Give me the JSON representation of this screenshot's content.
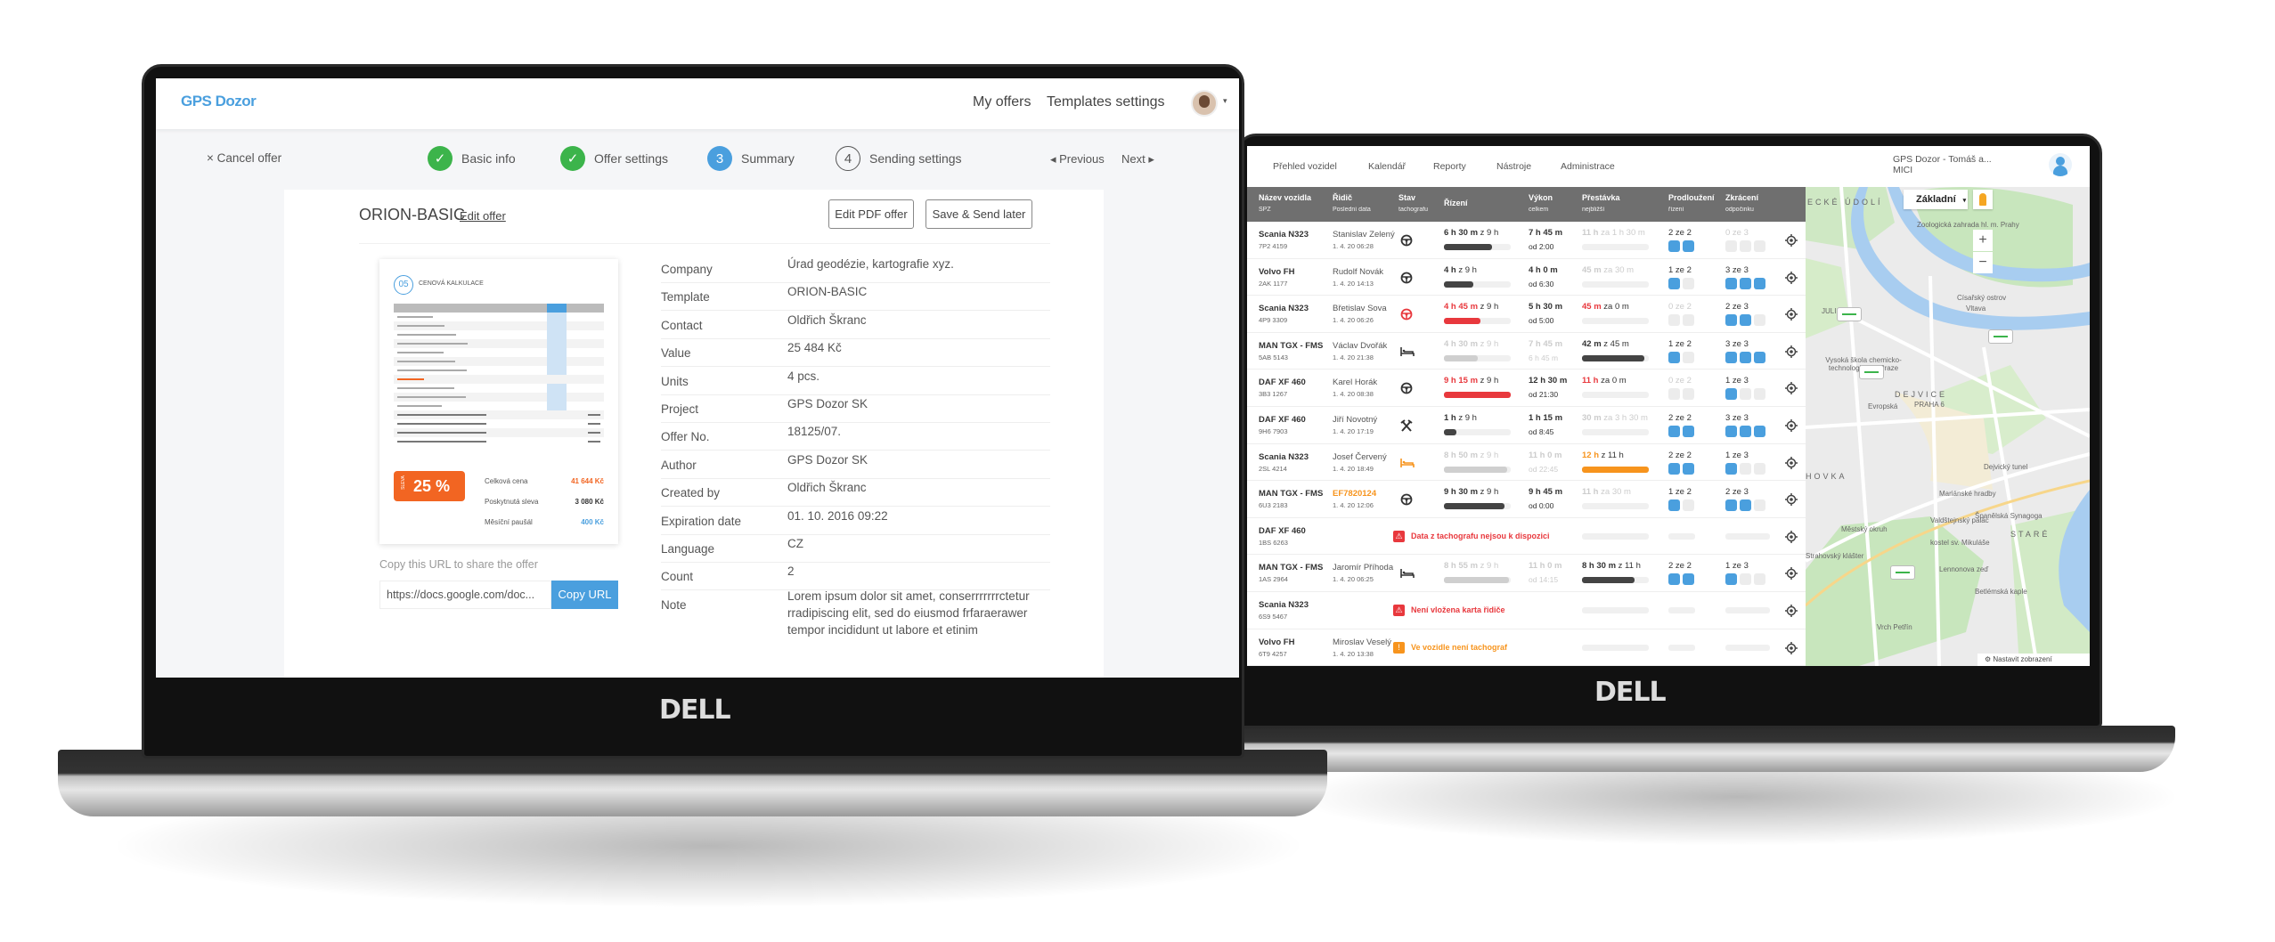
{
  "left_app": {
    "logo": "GPS Dozor",
    "nav": {
      "my_offers": "My offers",
      "templates_settings": "Templates settings"
    },
    "cancel": "× Cancel offer",
    "steps": [
      {
        "num": "✓",
        "label": "Basic info",
        "state": "done"
      },
      {
        "num": "✓",
        "label": "Offer settings",
        "state": "done"
      },
      {
        "num": "3",
        "label": "Summary",
        "state": "active"
      },
      {
        "num": "4",
        "label": "Sending settings",
        "state": "todo"
      }
    ],
    "previous": "◂ Previous",
    "next": "Next ▸",
    "title": "ORION-BASIC",
    "edit_offer": "Edit offer",
    "edit_pdf": "Edit PDF offer",
    "save_send": "Save & Send later",
    "preview": {
      "num": "05",
      "heading": "CENOVÁ KALKULACE",
      "sleva": "SLEVA",
      "discount": "25 %",
      "total_label": "Celková cena",
      "total": "41 644 Kč",
      "discount_label": "Poskytnutá sleva",
      "discount_value": "3 080 Kč",
      "monthly_label": "Měsíční paušál",
      "monthly": "400 Kč"
    },
    "share_label": "Copy this URL to share the offer",
    "share_url": "https://docs.google.com/doc...",
    "copy_url": "Copy URL",
    "details": [
      {
        "label": "Company",
        "value": "Úrad geodézie, kartografie xyz."
      },
      {
        "label": "Template",
        "value": "ORION-BASIC"
      },
      {
        "label": "Contact",
        "value": "Oldřich Škranc"
      },
      {
        "label": "Value",
        "value": "25 484 Kč"
      },
      {
        "label": "Units",
        "value": "4 pcs."
      },
      {
        "label": "Project",
        "value": "GPS Dozor SK"
      },
      {
        "label": "Offer No.",
        "value": "18125/07."
      },
      {
        "label": "Author",
        "value": "GPS Dozor SK"
      },
      {
        "label": "Created by",
        "value": "Oldřich Škranc"
      },
      {
        "label": "Expiration date",
        "value": "01. 10. 2016 09:22"
      },
      {
        "label": "Language",
        "value": "CZ"
      },
      {
        "label": "Count",
        "value": "2"
      },
      {
        "label": "Note",
        "value": "Lorem ipsum dolor sit amet, conserrrrrrrctetur rradipiscing elit, sed do eiusmod frfaraerawer tempor incididunt ut labore et etinim"
      }
    ],
    "colors": {
      "green": "#3cb44b",
      "blue": "#4a9fde",
      "orange": "#f26522"
    }
  },
  "right_app": {
    "nav": [
      "Přehled vozidel",
      "Kalendář",
      "Reporty",
      "Nástroje",
      "Administrace"
    ],
    "account": "GPS Dozor - Tomáš a...",
    "account_sub": "MICI",
    "columns": [
      {
        "t": "Název vozidla",
        "s": "SPZ"
      },
      {
        "t": "Řidič",
        "s": "Poslední data"
      },
      {
        "t": "Stav",
        "s": "tachografu"
      },
      {
        "t": "Řízení",
        "s": ""
      },
      {
        "t": "Výkon",
        "s": "celkem"
      },
      {
        "t": "Přestávka",
        "s": "nejbližší"
      },
      {
        "t": "Prodloužení",
        "s": "řízení"
      },
      {
        "t": "Zkrácení",
        "s": "odpočinku"
      }
    ],
    "rows": [
      {
        "name": "Scania N323",
        "plate": "7P2 4159",
        "driver": "Stanislav Zelený",
        "date": "1. 4. 20 06:28",
        "icon": "steering-wheel",
        "drive": "6 h 30 m",
        "drive_of": "z 9 h",
        "drive_pct": 72,
        "drive_color": "dark",
        "work": "7 h 45 m",
        "work_sub": "od 2:00",
        "brk": "11 h",
        "brk_sub": "za 1 h 30 m",
        "brk_pct": 0,
        "brk_faded": true,
        "ext": "2 ze 2",
        "ext_sq": [
          1,
          1
        ],
        "red": "0 ze 3",
        "red_sq": [
          0,
          0,
          0
        ],
        "red_faded": true
      },
      {
        "name": "Volvo FH",
        "plate": "2AK 1177",
        "driver": "Rudolf Novák",
        "date": "1. 4. 20 14:13",
        "icon": "steering-wheel",
        "drive": "4 h",
        "drive_of": "z 9 h",
        "drive_pct": 44,
        "drive_color": "dark",
        "work": "4 h 0 m",
        "work_sub": "od 6:30",
        "brk": "45 m",
        "brk_sub": "za 30 m",
        "brk_pct": 0,
        "brk_faded": true,
        "ext": "1 ze 2",
        "ext_sq": [
          1,
          0
        ],
        "red": "3 ze 3",
        "red_sq": [
          1,
          1,
          1
        ]
      },
      {
        "name": "Scania N323",
        "plate": "4P9 3309",
        "driver": "Břetislav Sova",
        "date": "1. 4. 20 06:26",
        "icon": "steering-wheel-red",
        "drive": "4 h 45 m",
        "drive_of": "z 9 h",
        "drive_pct": 55,
        "drive_color": "red",
        "drive_red": true,
        "work": "5 h 30 m",
        "work_sub": "od 5:00",
        "brk": "45 m",
        "brk_sub": "za 0 m",
        "brk_pct": 0,
        "brk_red": true,
        "ext": "0 ze 2",
        "ext_sq": [
          0,
          0
        ],
        "ext_faded": true,
        "red": "2 ze 3",
        "red_sq": [
          1,
          1,
          0
        ]
      },
      {
        "name": "MAN TGX - FMS",
        "plate": "5AB 5143",
        "driver": "Václav Dvořák",
        "date": "1. 4. 20 21:38",
        "icon": "bed",
        "drive": "4 h 30 m",
        "drive_of": "z 9 h",
        "drive_pct": 50,
        "drive_color": "light",
        "drive_faded": true,
        "work": "7 h 45 m",
        "work_sub": "6 h 45 m",
        "work_faded": true,
        "brk": "42 m",
        "brk_sub": "z 45 m",
        "brk_pct": 93,
        "brk_color": "dark",
        "ext": "1 ze 2",
        "ext_sq": [
          1,
          0
        ],
        "red": "3 ze 3",
        "red_sq": [
          1,
          1,
          1
        ]
      },
      {
        "name": "DAF XF 460",
        "plate": "3B3 1267",
        "driver": "Karel Horák",
        "date": "1. 4. 20 08:38",
        "icon": "steering-wheel",
        "drive": "9 h 15 m",
        "drive_of": "z 9 h",
        "drive_pct": 100,
        "drive_color": "red",
        "drive_red": true,
        "work": "12 h 30 m",
        "work_sub": "od 21:30",
        "brk": "11 h",
        "brk_sub": "za 0 m",
        "brk_pct": 0,
        "brk_red": true,
        "ext": "0 ze 2",
        "ext_sq": [
          0,
          0
        ],
        "ext_faded": true,
        "red": "1 ze 3",
        "red_sq": [
          1,
          0,
          0
        ]
      },
      {
        "name": "DAF XF 460",
        "plate": "9H6 7903",
        "driver": "Jiří Novotný",
        "date": "1. 4. 20 17:19",
        "icon": "hammers",
        "drive": "1 h",
        "drive_of": "z 9 h",
        "drive_pct": 19,
        "drive_color": "dark",
        "work": "1 h 15 m",
        "work_sub": "od 8:45",
        "brk": "30 m",
        "brk_sub": "za 3 h 30 m",
        "brk_pct": 0,
        "brk_faded": true,
        "ext": "2 ze 2",
        "ext_sq": [
          1,
          1
        ],
        "red": "3 ze 3",
        "red_sq": [
          1,
          1,
          1
        ]
      },
      {
        "name": "Scania N323",
        "plate": "2SL 4214",
        "driver": "Josef Červený",
        "date": "1. 4. 20 18:49",
        "icon": "bed-orange",
        "drive": "8 h 50 m",
        "drive_of": "z 9 h",
        "drive_pct": 95,
        "drive_color": "light",
        "drive_faded": true,
        "work": "11 h 0 m",
        "work_sub": "od 22:45",
        "work_faded": true,
        "brk": "12 h",
        "brk_sub": "z 11 h",
        "brk_pct": 100,
        "brk_color": "orange",
        "brk_orange": true,
        "ext": "2 ze 2",
        "ext_sq": [
          1,
          1
        ],
        "red": "1 ze 3",
        "red_sq": [
          1,
          0,
          0
        ]
      },
      {
        "name": "MAN TGX - FMS",
        "plate": "6U3 2183",
        "driver": "EF7820124",
        "driver_orange": true,
        "date": "1. 4. 20 12:06",
        "icon": "steering-wheel",
        "drive": "9 h 30 m",
        "drive_of": "z 9 h",
        "drive_pct": 90,
        "drive_color": "dark",
        "work": "9 h 45 m",
        "work_sub": "od 0:00",
        "brk": "11 h",
        "brk_sub": "za 30 m",
        "brk_pct": 0,
        "brk_faded": true,
        "ext": "1 ze 2",
        "ext_sq": [
          1,
          0
        ],
        "red": "2 ze 3",
        "red_sq": [
          1,
          1,
          0
        ]
      },
      {
        "name": "DAF XF 460",
        "plate": "1BS 6263",
        "alert": "Data z tachografu nejsou k dispozici",
        "alert_type": "red"
      },
      {
        "name": "MAN TGX - FMS",
        "plate": "1AS 2964",
        "driver": "Jaromír Příhoda",
        "date": "1. 4. 20 06:25",
        "icon": "bed",
        "drive": "8 h 55 m",
        "drive_of": "z 9 h",
        "drive_pct": 97,
        "drive_color": "light",
        "drive_faded": true,
        "work": "11 h 0 m",
        "work_sub": "od 14:15",
        "work_faded": true,
        "brk": "8 h 30 m",
        "brk_sub": "z 11 h",
        "brk_pct": 78,
        "brk_color": "dark",
        "ext": "2 ze 2",
        "ext_sq": [
          1,
          1
        ],
        "red": "1 ze 3",
        "red_sq": [
          1,
          0,
          0
        ]
      },
      {
        "name": "Scania N323",
        "plate": "6S9 5467",
        "alert": "Není vložena karta řidiče",
        "alert_type": "red"
      },
      {
        "name": "Volvo FH",
        "plate": "6T9 4257",
        "driver": "Miroslav Veselý",
        "date": "1. 4. 20 13:38",
        "alert": "Ve vozidle není tachograf",
        "alert_type": "orange"
      }
    ],
    "map": {
      "type_select": "Základní",
      "zoom_in": "+",
      "zoom_out": "−",
      "settings": "Nastavit zobrazení",
      "labels": [
        "ECKÉ ÚDOLÍ",
        "Zoologická zahrada hl. m. Prahy",
        "Císařský ostrov",
        "Vltava",
        "JULIS",
        "Vysoká škola chemicko-technologická v Praze",
        "DEJVICE",
        "PRAHA 6",
        "Evropská",
        "Dejvický tunel",
        "HOVKA",
        "Městský okruh",
        "Mariánské hradby",
        "Valdštejnský palác",
        "Španělská Synagoga",
        "kostel sv. Mikuláše",
        "Strahovský klášter",
        "Lennonova zeď",
        "Betlémská kaple",
        "Vrch Petřín",
        "STARÉ"
      ]
    },
    "colors": {
      "red": "#e8383d",
      "orange": "#f7941d",
      "blue": "#4a9fde",
      "dark": "#444444",
      "header": "#6f6f6f"
    }
  },
  "brand": "DELL"
}
